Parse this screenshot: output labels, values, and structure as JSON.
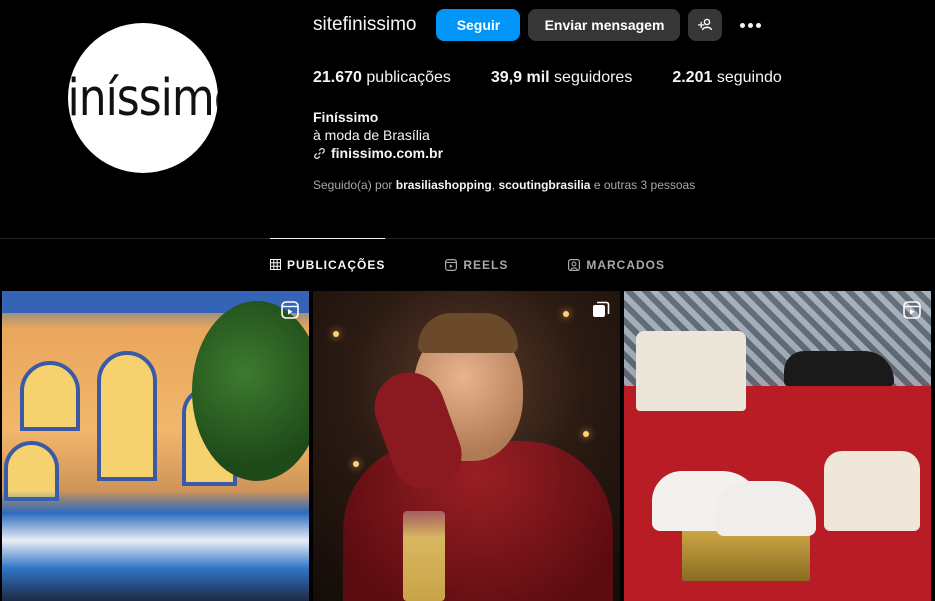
{
  "profile": {
    "username": "sitefinissimo",
    "logo_text": "Finíssimo",
    "follow_label": "Seguir",
    "message_label": "Enviar mensagem"
  },
  "stats": [
    {
      "value": "21.670",
      "label": "publicações"
    },
    {
      "value": "39,9 mil",
      "label": "seguidores"
    },
    {
      "value": "2.201",
      "label": "seguindo"
    }
  ],
  "bio": {
    "name": "Finíssimo",
    "tagline": "à moda de Brasília",
    "link": "finissimo.com.br"
  },
  "followed_by": {
    "prefix": "Seguido(a) por",
    "user1": "brasiliashopping",
    "separator": ",",
    "user2": "scoutingbrasilia",
    "suffix": "e outras 3 pessoas"
  },
  "tabs": [
    {
      "label": "PUBLICAÇÕES",
      "icon": "grid-icon",
      "active": true
    },
    {
      "label": "REELS",
      "icon": "reels-icon",
      "active": false
    },
    {
      "label": "MARCADOS",
      "icon": "tagged-icon",
      "active": false
    }
  ],
  "posts": [
    {
      "type": "reel",
      "icon": "reel-icon"
    },
    {
      "type": "carousel",
      "icon": "carousel-icon"
    },
    {
      "type": "reel",
      "icon": "reel-icon"
    }
  ],
  "colors": {
    "background": "#000000",
    "accent": "#0095f6",
    "button_secondary": "#363636",
    "muted_text": "#a8a8a8"
  }
}
